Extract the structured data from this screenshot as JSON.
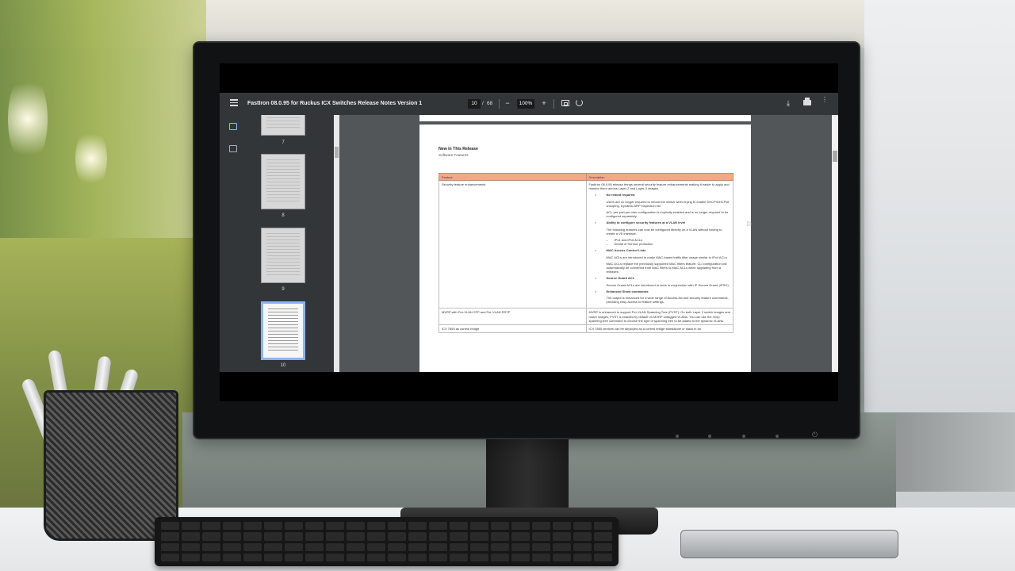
{
  "viewer": {
    "doc_title": "FastIron 08.0.95 for Ruckus ICX Switches Release Notes Version 1",
    "current_page": "10",
    "page_separator": "/",
    "total_pages": "68",
    "zoom_minus": "−",
    "zoom": "100%",
    "zoom_plus": "+",
    "download_glyph": "⤓",
    "more_glyph": "⋮"
  },
  "sidebar": {
    "thumbnails": [
      {
        "number": "7"
      },
      {
        "number": "8"
      },
      {
        "number": "9"
      },
      {
        "number": "10",
        "active": true
      }
    ]
  },
  "page": {
    "section_title": "New in This Release",
    "section_subtitle": "Software Features",
    "table": {
      "headers": [
        "Feature",
        "Description"
      ],
      "row1_feature": "Security feature enhancements",
      "row1_intro": "FastIron 08.0.95 release brings several security feature enhancements making it easier to apply and monitor them across Layer-2 and Layer-3 images.",
      "b1": "No reboot required",
      "b1_p1": "Users are no longer required to reboot the switch when trying to enable DHCP/DHCPv6 snooping, Dynamic ARP inspection etc.",
      "b1_p2": "ACL-per-port-per-vlan configuration is implicitly enabled and is no longer required to be configured separately",
      "b2": "Ability to configure security features at a VLAN level",
      "b2_p1": "The following features can now be configured directly on a VLAN without having to create a VE interface.",
      "b2_d1": "IPv4 and IPv6 ACLs",
      "b2_d2": "Denial of Service protection",
      "b3": "MAC Access Control Lists",
      "b3_p1": "MAC ACLs are introduced to make MAC-based traffic filter usage similar to IPv4 ACLs.",
      "b3_p2": "MAC ACLs replace the previously supported MAC filters feature. CLI configuration will automatically be converted from MAC filters to MAC ACLs when upgrading from a releases.",
      "b4": "Source Guard ACL",
      "b4_p1": "Source Guard ACLs are introduced to work in conjunction with IP Source Guard (IPSG).",
      "b5": "Enhanced Show commands",
      "b5_p1": "The output is enhanced for a wide range of Access-list and security feature commands, providing easy access to feature settings.",
      "row2_feature": "MVRP with Per-VLAN STP and Per-VLAN RSTP",
      "row2_desc": "MVRP is enhanced to support Per-VLAN Spanning Tree (PVST). On both Layer 2 switch images and router images, PVST is enabled by default on MVRP untagged VLANs. You can use the mvrp spanning-tree command to choose the type of spanning tree to be added to the dynamic VLANs.",
      "row3_feature": "ICX 7850 as control bridge",
      "row3_desc": "ICX 7850 devices can be deployed as a control bridge standalone or stack in an"
    }
  },
  "monitor": {
    "power_glyph": "⏻"
  }
}
